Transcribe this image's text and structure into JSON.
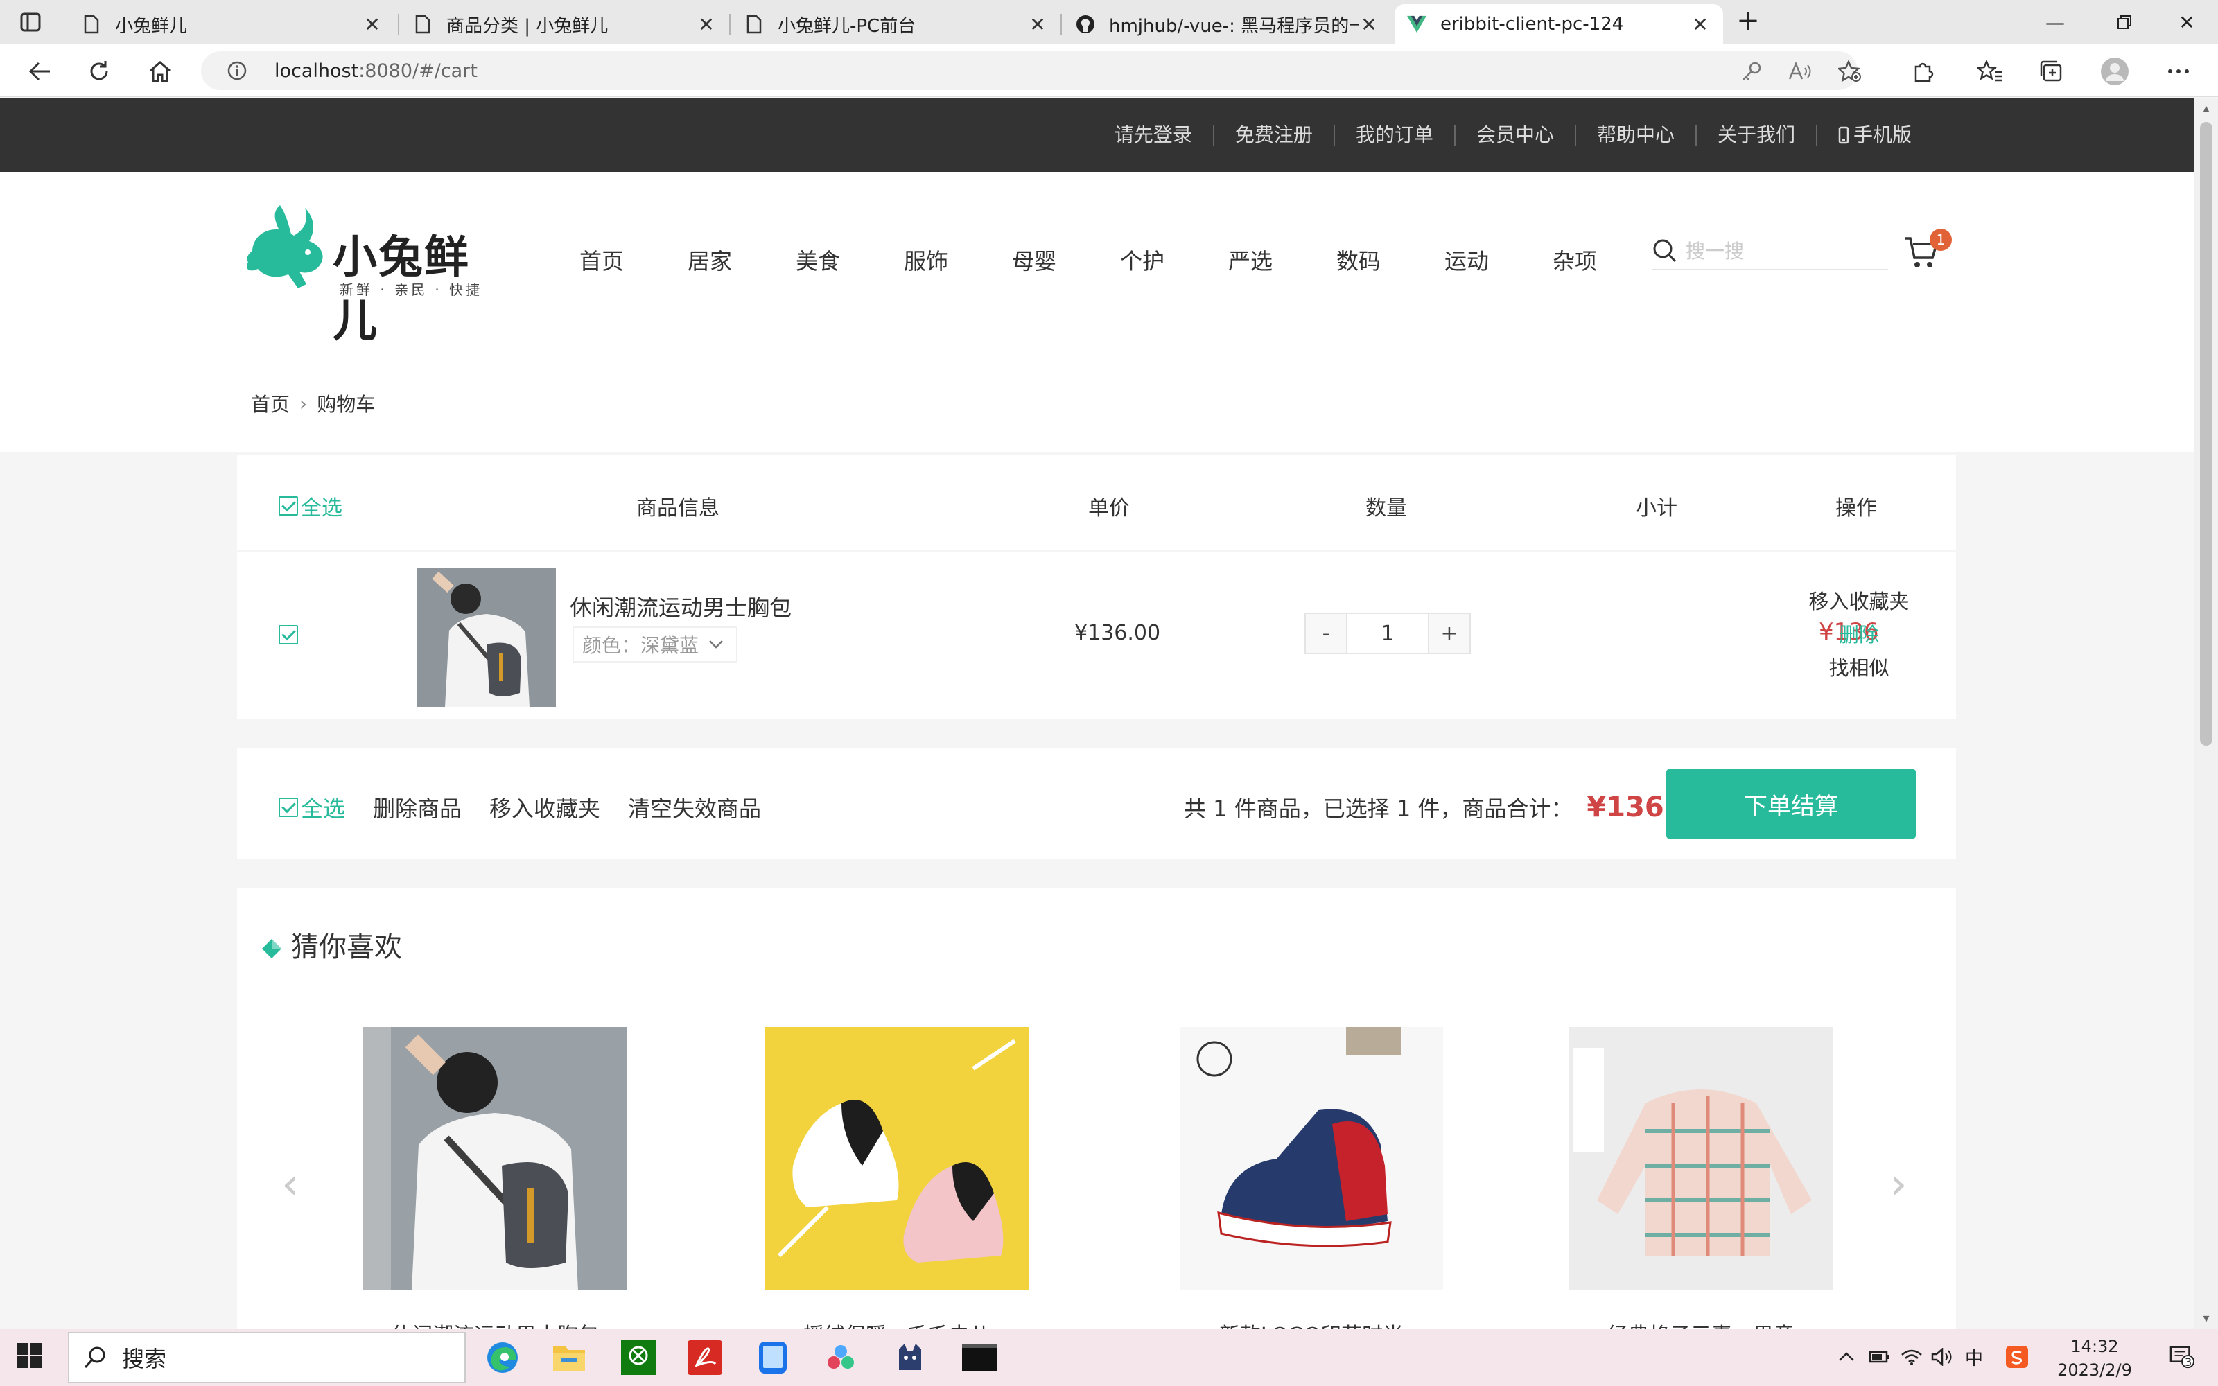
{
  "browser": {
    "tabs": [
      {
        "title": "小兔鲜儿",
        "active": false
      },
      {
        "title": "商品分类 | 小兔鲜儿",
        "active": false
      },
      {
        "title": "小兔鲜儿-PC前台",
        "active": false
      },
      {
        "title": "hmjhub/-vue-: 黑马程序员的一个",
        "active": false
      },
      {
        "title": "eribbit-client-pc-124",
        "active": true
      }
    ],
    "url_host": "localhost",
    "url_path": ":8080/#/cart"
  },
  "topnav": {
    "links": [
      "请先登录",
      "免费注册",
      "我的订单",
      "会员中心",
      "帮助中心",
      "关于我们"
    ],
    "mobile": "手机版"
  },
  "header": {
    "brand": "小兔鲜儿",
    "slogan": "新鲜 · 亲民 · 快捷",
    "nav": [
      "首页",
      "居家",
      "美食",
      "服饰",
      "母婴",
      "个护",
      "严选",
      "数码",
      "运动",
      "杂项"
    ],
    "search_placeholder": "搜一搜",
    "cart_count": "1"
  },
  "breadcrumb": {
    "home": "首页",
    "current": "购物车"
  },
  "cart": {
    "columns": {
      "select_all": "全选",
      "info": "商品信息",
      "price": "单价",
      "qty": "数量",
      "subtotal": "小计",
      "ops": "操作"
    },
    "items": [
      {
        "name": "休闲潮流运动男士胸包",
        "attr": "颜色：深黛蓝",
        "price": "¥136.00",
        "qty": "1",
        "subtotal": "¥136",
        "ops": [
          "移入收藏夹",
          "删除",
          "找相似"
        ]
      }
    ]
  },
  "actionbar": {
    "select_all": "全选",
    "delete": "删除商品",
    "move_fav": "移入收藏夹",
    "clear_invalid": "清空失效商品",
    "summary": "共 1 件商品，已选择 1 件，商品合计：",
    "total": "¥136",
    "checkout": "下单结算"
  },
  "guess": {
    "title": "猜你喜欢",
    "items": [
      {
        "name": "休闲潮流运动男士胸包"
      },
      {
        "name": "摇绒保暖，毛毛虫儿"
      },
      {
        "name": "新款LOGO印花时尚"
      },
      {
        "name": "经典格子元素，男童"
      }
    ]
  },
  "taskbar": {
    "search": "搜索",
    "time": "14:32",
    "date": "2023/2/9",
    "ime": "中",
    "notif_count": "3"
  },
  "colors": {
    "accent": "#27ba9b",
    "price": "#cf4444",
    "topbar": "#333333",
    "badge": "#e26237"
  }
}
